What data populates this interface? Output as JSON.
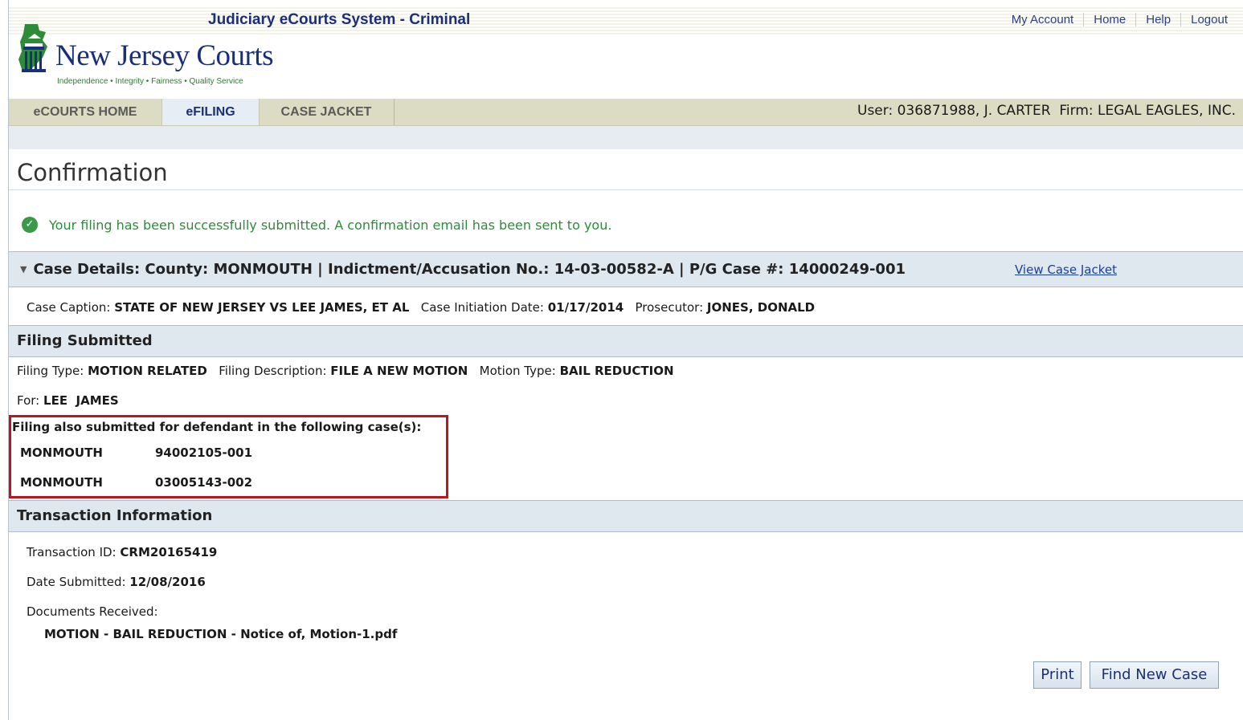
{
  "header": {
    "system_title": "Judiciary eCourts System - Criminal",
    "top_links": [
      "My Account",
      "Home",
      "Help",
      "Logout"
    ],
    "logo_name": "New Jersey Courts",
    "logo_tagline": "Independence • Integrity • Fairness • Quality Service"
  },
  "nav": {
    "tabs": [
      "eCOURTS HOME",
      "eFILING",
      "CASE JACKET"
    ],
    "active_tab": "eFILING",
    "user_label": "User:",
    "user_value": "036871988, J. CARTER",
    "firm_label": "Firm:",
    "firm_value": "LEGAL EAGLES, INC."
  },
  "page": {
    "title": "Confirmation",
    "success_message": "Your filing has been successfully submitted. A confirmation email has been sent to you."
  },
  "case_details": {
    "header": "Case Details: County: MONMOUTH | Indictment/Accusation No.: 14-03-00582-A | P/G Case #: 14000249-001",
    "view_case_jacket": "View Case Jacket",
    "caption_label": "Case Caption:",
    "caption_value": "STATE OF NEW JERSEY VS LEE JAMES, ET AL",
    "initiation_label": "Case Initiation Date:",
    "initiation_value": "01/17/2014",
    "prosecutor_label": "Prosecutor:",
    "prosecutor_value": "JONES, DONALD"
  },
  "filing_submitted": {
    "header": "Filing Submitted",
    "filing_type_label": "Filing Type:",
    "filing_type_value": "MOTION RELATED",
    "filing_desc_label": "Filing Description:",
    "filing_desc_value": "FILE A NEW MOTION",
    "motion_type_label": "Motion Type:",
    "motion_type_value": "BAIL REDUCTION",
    "for_label": "For:",
    "for_value": "LEE  JAMES",
    "also_submitted": "Filing also submitted for defendant in the following case(s):",
    "related_cases": [
      {
        "county": "MONMOUTH",
        "case": "94002105-001"
      },
      {
        "county": "MONMOUTH",
        "case": "03005143-002"
      }
    ]
  },
  "transaction": {
    "header": "Transaction Information",
    "id_label": "Transaction ID:",
    "id_value": "CRM20165419",
    "date_label": "Date Submitted:",
    "date_value": "12/08/2016",
    "docs_label": "Documents Received:",
    "docs_value": "MOTION - BAIL REDUCTION - Notice of, Motion-1.pdf"
  },
  "buttons": {
    "print": "Print",
    "find_new_case": "Find New Case"
  },
  "colors": {
    "brand_blue": "#1a2f7a",
    "success_green": "#2e8b3a",
    "highlight_red": "#c0151c",
    "section_bg": "#dfe7ef"
  }
}
